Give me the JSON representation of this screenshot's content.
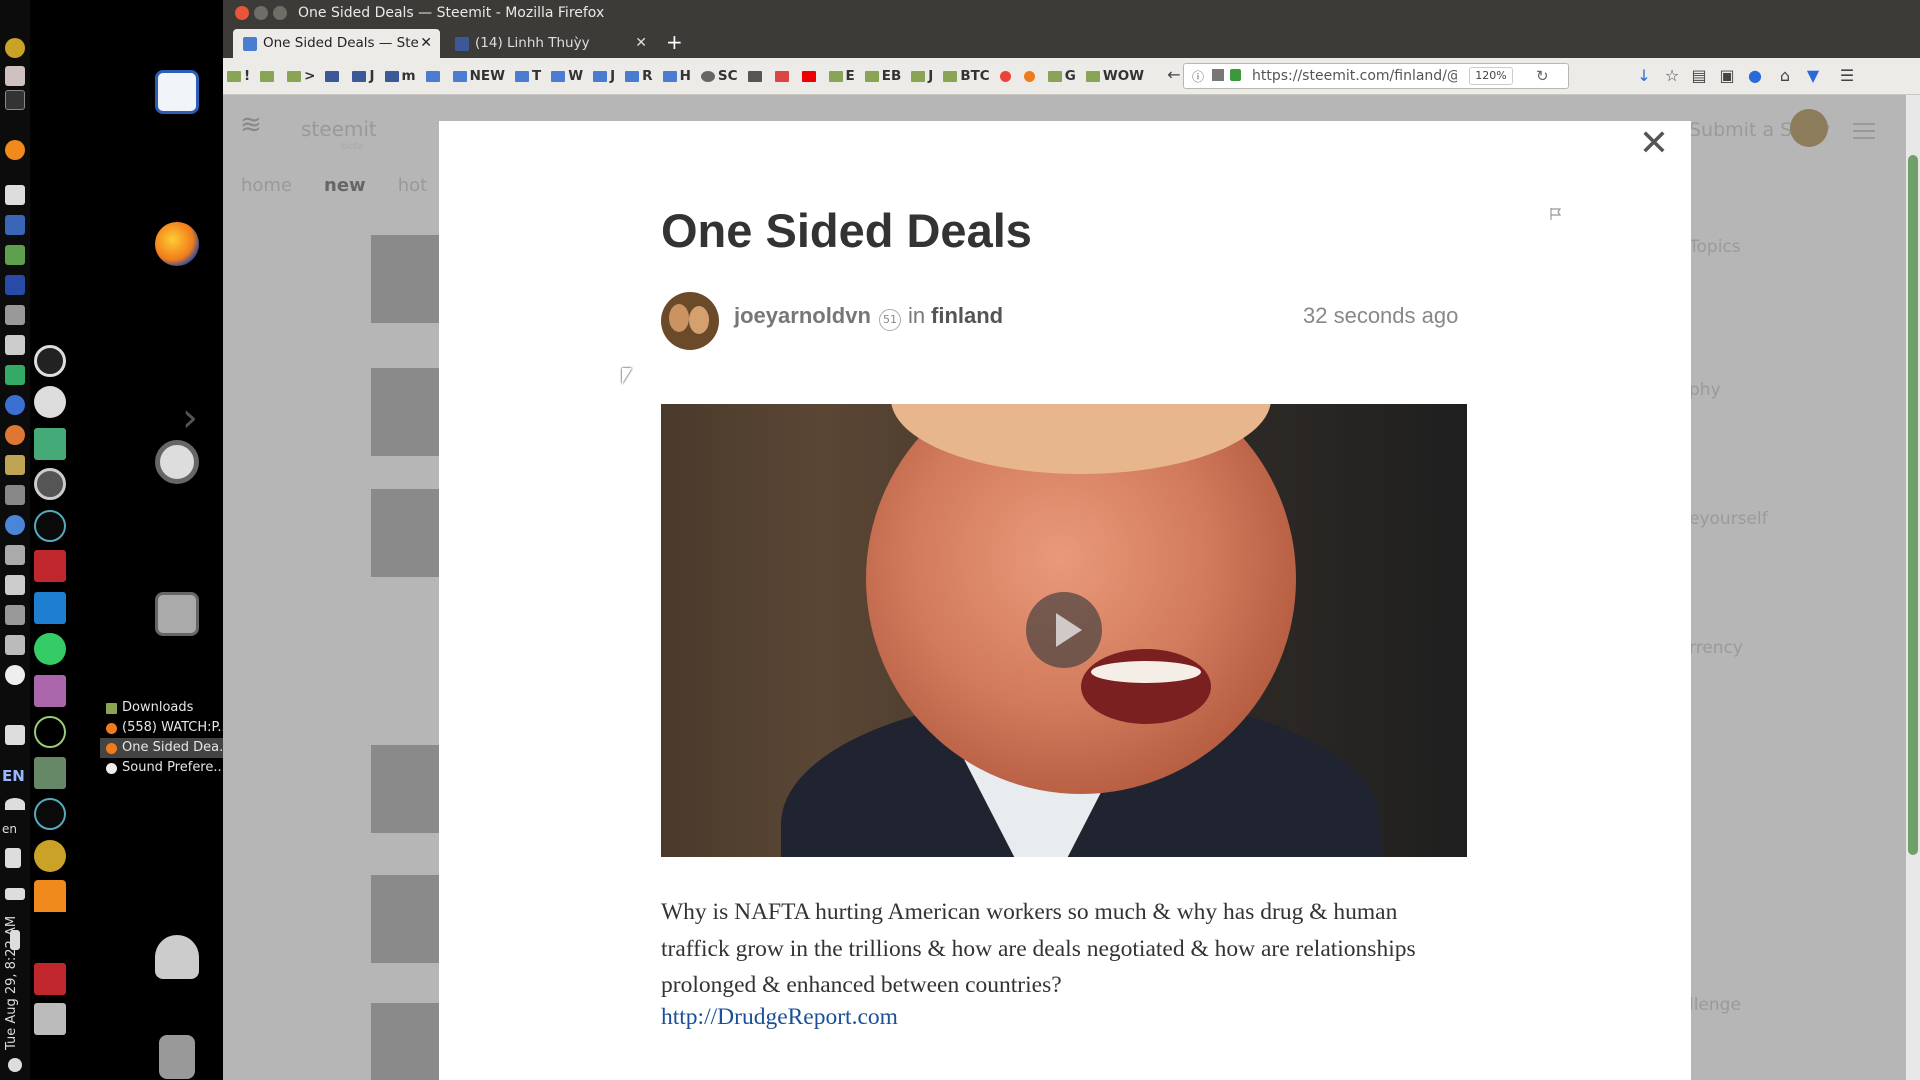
{
  "taskbar": {
    "keyboard_label": "EN",
    "lang_label": "en",
    "clock": "Tue Aug 29,  8:22 AM"
  },
  "dock": {
    "windows": [
      {
        "label": "Downloads",
        "active": false
      },
      {
        "label": "(558) WATCH:P...",
        "active": false
      },
      {
        "label": "One Sided Dea...",
        "active": true
      },
      {
        "label": "Sound Prefere...",
        "active": false
      }
    ]
  },
  "firefox": {
    "window_title": "One Sided Deals — Steemit - Mozilla Firefox",
    "tabs": [
      {
        "label": "One Sided Deals — Ste",
        "active": true,
        "color": "#4a7cd1"
      },
      {
        "label": "(14) Linhh Thuỳy",
        "active": false,
        "color": "#3b5998"
      }
    ],
    "new_tab": "+",
    "bookmarks": [
      "!",
      ">",
      "J",
      "m",
      "NEW",
      "T",
      "W",
      "J",
      "R",
      "H",
      "SC",
      "E",
      "EB",
      "J",
      "BTC",
      "G",
      "G",
      "WOW"
    ],
    "url": "https://steemit.com/finland/@joeyarnoldvn/one-sided-deals",
    "zoom": "120%"
  },
  "page": {
    "logo_text": "steemit",
    "beta_text": "beta",
    "nav": [
      {
        "label": "home",
        "active": false
      },
      {
        "label": "new",
        "active": true
      },
      {
        "label": "hot",
        "active": false
      }
    ],
    "header_action": "Submit a Story",
    "side_words": [
      "Topics",
      "phy",
      "eyourself",
      "rrency",
      "llenge"
    ]
  },
  "post": {
    "title": "One Sided Deals",
    "author": "joeyarnoldvn",
    "reputation": "51",
    "in_label": "in",
    "category": "finland",
    "time_ago": "32 seconds ago",
    "body": "Why is NAFTA hurting American workers so much & why has drug & human traffick grow in the trillions & how are deals negotiated & how are relationships prolonged & enhanced between countries?",
    "link": "http://DrudgeReport.com",
    "close_label": "✕"
  },
  "colors": {
    "link": "#1a5099",
    "title_bar": "#3c3b37",
    "scrollbar_thumb": "#6fa06a",
    "close_button": "#e8553a"
  }
}
